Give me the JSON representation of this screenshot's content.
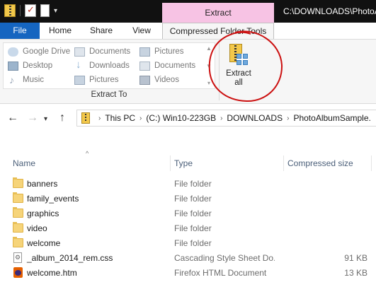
{
  "window": {
    "title": "C:\\DOWNLOADS\\PhotoA",
    "context_tab": "Extract"
  },
  "ribbon_tabs": [
    {
      "label": "File"
    },
    {
      "label": "Home"
    },
    {
      "label": "Share"
    },
    {
      "label": "View"
    },
    {
      "label": "Compressed Folder Tools"
    }
  ],
  "extract_to": {
    "group_label": "Extract To",
    "locations": [
      {
        "label": "Google Drive",
        "icon": "cloud-icon"
      },
      {
        "label": "Desktop",
        "icon": "desktop-icon"
      },
      {
        "label": "Music",
        "icon": "music-icon"
      },
      {
        "label": "Documents",
        "icon": "documents-icon"
      },
      {
        "label": "Downloads",
        "icon": "downloads-icon"
      },
      {
        "label": "Pictures",
        "icon": "pictures-icon"
      },
      {
        "label": "Pictures",
        "icon": "pictures-icon"
      },
      {
        "label": "Documents",
        "icon": "documents-icon"
      },
      {
        "label": "Videos",
        "icon": "videos-icon"
      }
    ],
    "extract_all_line1": "Extract",
    "extract_all_line2": "all"
  },
  "annotation": {
    "color": "#cc1111"
  },
  "address_bar": {
    "crumbs": [
      "This PC",
      "(C:) Win10-223GB",
      "DOWNLOADS",
      "PhotoAlbumSample."
    ]
  },
  "columns": {
    "name": "Name",
    "type": "Type",
    "size": "Compressed size"
  },
  "files": [
    {
      "name": "banners",
      "type": "File folder",
      "size": "",
      "icon": "folder-icon"
    },
    {
      "name": "family_events",
      "type": "File folder",
      "size": "",
      "icon": "folder-icon"
    },
    {
      "name": "graphics",
      "type": "File folder",
      "size": "",
      "icon": "folder-icon"
    },
    {
      "name": "video",
      "type": "File folder",
      "size": "",
      "icon": "folder-icon"
    },
    {
      "name": "welcome",
      "type": "File folder",
      "size": "",
      "icon": "folder-icon"
    },
    {
      "name": "_album_2014_rem.css",
      "type": "Cascading Style Sheet Do...",
      "size": "91 KB",
      "icon": "css-file-icon"
    },
    {
      "name": "welcome.htm",
      "type": "Firefox HTML Document",
      "size": "13 KB",
      "icon": "firefox-html-icon"
    }
  ]
}
